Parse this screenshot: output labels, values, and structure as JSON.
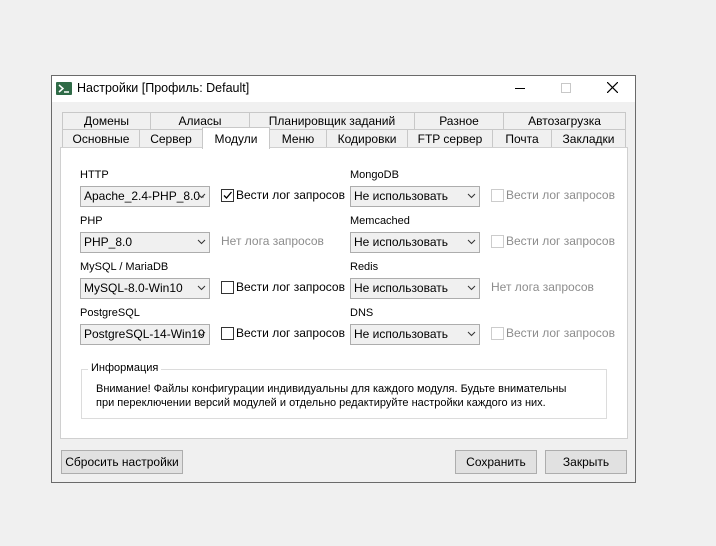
{
  "window": {
    "title": "Настройки [Профиль: Default]"
  },
  "tabs_row_top": [
    "Домены",
    "Алиасы",
    "Планировщик заданий",
    "Разное",
    "Автозагрузка"
  ],
  "tabs_row_bottom": [
    "Основные",
    "Сервер",
    "Модули",
    "Меню",
    "Кодировки",
    "FTP сервер",
    "Почта",
    "Закладки"
  ],
  "active_tab": "Модули",
  "modules": {
    "http": {
      "label": "HTTP",
      "value": "Apache_2.4-PHP_8.0-",
      "option": "Вести лог запросов",
      "checked": true
    },
    "php": {
      "label": "PHP",
      "value": "PHP_8.0",
      "note": "Нет лога запросов"
    },
    "mysql": {
      "label": "MySQL / MariaDB",
      "value": "MySQL-8.0-Win10",
      "option": "Вести лог запросов",
      "checked": false
    },
    "postgres": {
      "label": "PostgreSQL",
      "value": "PostgreSQL-14-Win10",
      "option": "Вести лог запросов",
      "checked": false
    },
    "mongodb": {
      "label": "MongoDB",
      "value": "Не использовать",
      "option": "Вести лог запросов"
    },
    "memcached": {
      "label": "Memcached",
      "value": "Не использовать",
      "option": "Вести лог запросов"
    },
    "redis": {
      "label": "Redis",
      "value": "Не использовать",
      "note": "Нет лога запросов"
    },
    "dns": {
      "label": "DNS",
      "value": "Не использовать",
      "option": "Вести лог запросов"
    }
  },
  "info": {
    "title": "Информация",
    "text": "Внимание! Файлы конфигурации индивидуальны для каждого модуля. Будьте внимательны\nпри переключении версий модулей и отдельно редактируйте настройки каждого из них."
  },
  "buttons": {
    "reset": "Сбросить настройки",
    "save": "Сохранить",
    "close": "Закрыть"
  }
}
